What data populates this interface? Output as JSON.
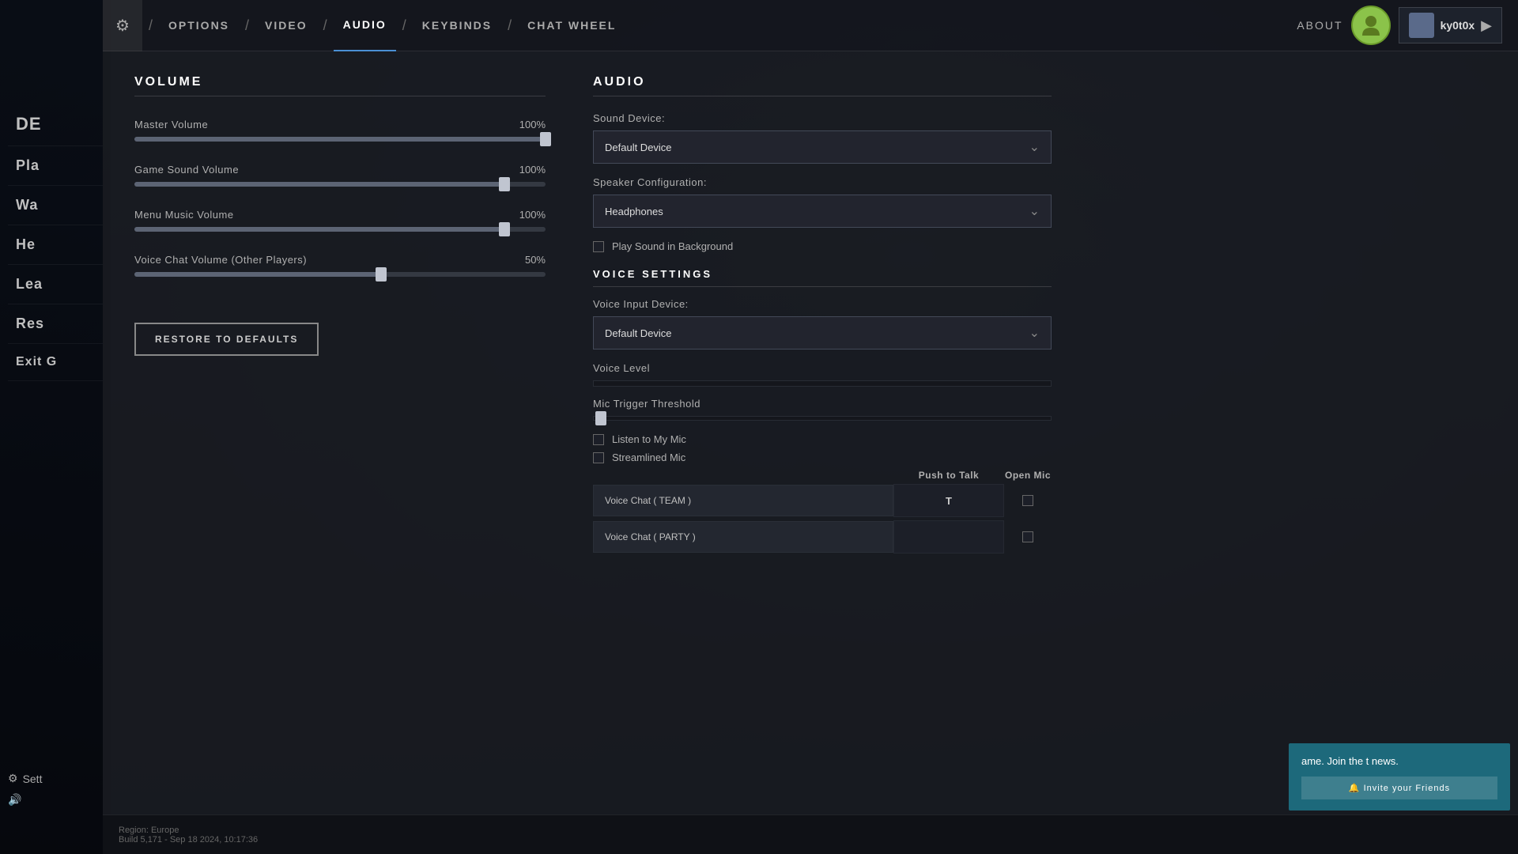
{
  "nav": {
    "options_label": "OPTIONS",
    "video_label": "VIDEO",
    "audio_label": "AUDIO",
    "keybinds_label": "KEYBINDS",
    "chat_wheel_label": "CHAT WHEEL",
    "about_label": "ABOUT"
  },
  "user": {
    "username": "ky0t0x",
    "avatar_placeholder": "avatar"
  },
  "left_menu": {
    "items": [
      "DE",
      "Pla",
      "Wa",
      "He",
      "Lea",
      "Res",
      "Exit G"
    ],
    "settings_label": "Sett",
    "audio_icon": "🔊"
  },
  "volume": {
    "section_title": "VOLUME",
    "controls": [
      {
        "label": "Master Volume",
        "value": "100%",
        "fill_pct": 100
      },
      {
        "label": "Game Sound Volume",
        "value": "100%",
        "fill_pct": 90
      },
      {
        "label": "Menu Music Volume",
        "value": "100%",
        "fill_pct": 90
      },
      {
        "label": "Voice Chat Volume (Other Players)",
        "value": "50%",
        "fill_pct": 60
      }
    ],
    "restore_label": "RESTORE TO DEFAULTS"
  },
  "audio": {
    "section_title": "AUDIO",
    "sound_device_label": "Sound Device:",
    "sound_device_value": "Default Device",
    "speaker_config_label": "Speaker Configuration:",
    "speaker_config_value": "Headphones",
    "play_sound_bg_label": "Play Sound in Background",
    "voice_settings_title": "VOICE SETTINGS",
    "voice_input_label": "Voice Input Device:",
    "voice_input_value": "Default Device",
    "voice_level_label": "Voice Level",
    "mic_threshold_label": "Mic Trigger Threshold",
    "listen_mic_label": "Listen to My Mic",
    "streamlined_mic_label": "Streamlined Mic",
    "col_push_to_talk": "Push to Talk",
    "col_open_mic": "Open Mic",
    "voice_rows": [
      {
        "label": "Voice Chat ( TEAM )",
        "keybind": "T",
        "open_mic": false
      },
      {
        "label": "Voice Chat ( PARTY )",
        "keybind": "",
        "open_mic": false
      }
    ]
  },
  "bottom": {
    "region": "Region: Europe",
    "build": "Build 5,171 - Sep 18 2024, 10:17:36"
  },
  "notification": {
    "text": "ame. Join the t news.",
    "invite_label": "🔔 Invite your Friends"
  }
}
